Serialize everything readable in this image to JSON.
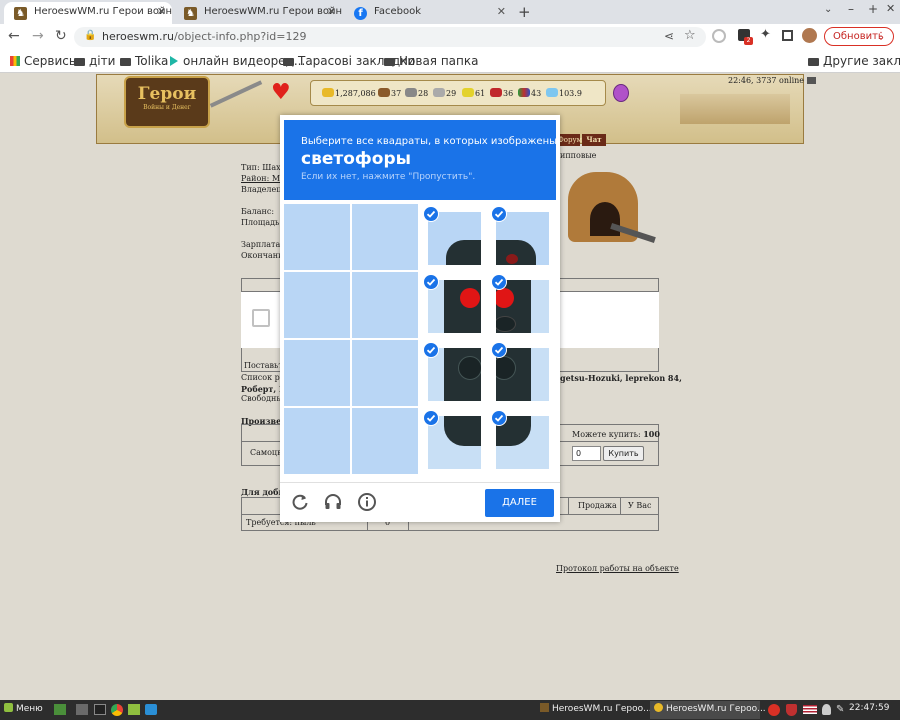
{
  "browser": {
    "tabs": [
      {
        "title": "HeroeswWM.ru Герои войны и Де",
        "active": true
      },
      {
        "title": "HeroeswWM.ru Герои войны и Д",
        "active": false
      },
      {
        "title": "Facebook",
        "active": false
      }
    ],
    "new_tab": "+",
    "url_host": "heroeswm.ru",
    "url_path": "/object-info.php?id=129",
    "update_label": "Обновить",
    "bookmarks": [
      "Сервисы",
      "діти",
      "Tolika",
      "онлайн видеоред...",
      "Тарасові закладки",
      "Новая папка"
    ],
    "other_bookmarks": "Другие закладки"
  },
  "game": {
    "logo": "Герои",
    "logo_sub": "Войны и Денег",
    "server_status": "22:46, 3737 online",
    "resources": [
      "1,287,086",
      "37",
      "28",
      "29",
      "61",
      "36",
      "43",
      "103.9"
    ],
    "nav_forum": "Форум",
    "nav_chat": "Чат",
    "top_right_text": "ипповые",
    "info_lines": [
      "Тип: Шахт",
      "Район: Mi",
      "Владелец:",
      "",
      "Баланс:",
      "Площадь:",
      "",
      "Зарплата:",
      "Окончани"
    ],
    "supply_label": "Поставьт",
    "list_line1_left": "Список ра",
    "list_line1_right": "getsu-Hozuki, leprekon 84,",
    "list_line2": "Роберт, П",
    "list_line3": "Свободны",
    "produced_label": "Произвед",
    "can_buy_label": "Можете купить:",
    "can_buy_value": "100",
    "row_label": "Самоцв",
    "qty_value": "0",
    "buy_button": "Купить",
    "mining_label": "Для добы",
    "sale_col": "Продажа",
    "you_have_col": "У Вас",
    "required_label": "Требуется: пыль",
    "required_value": "0",
    "protocol_link": "Протокол работы на объекте"
  },
  "captcha": {
    "instruction": "Выберите все квадраты, в которых изображены",
    "target": "светофоры",
    "hint": "Если их нет, нажмите \"Пропустить\".",
    "verify_button": "ДАЛЕЕ"
  },
  "taskbar": {
    "menu": "Меню",
    "windows": [
      "HeroesWM.ru Героо...",
      "HeroesWM.ru Героо..."
    ],
    "clock": "22:47:59"
  },
  "colors": {
    "accent": "#1a73e8",
    "tile": "#b9d6f5",
    "taskbar": "#2d2d2d"
  }
}
